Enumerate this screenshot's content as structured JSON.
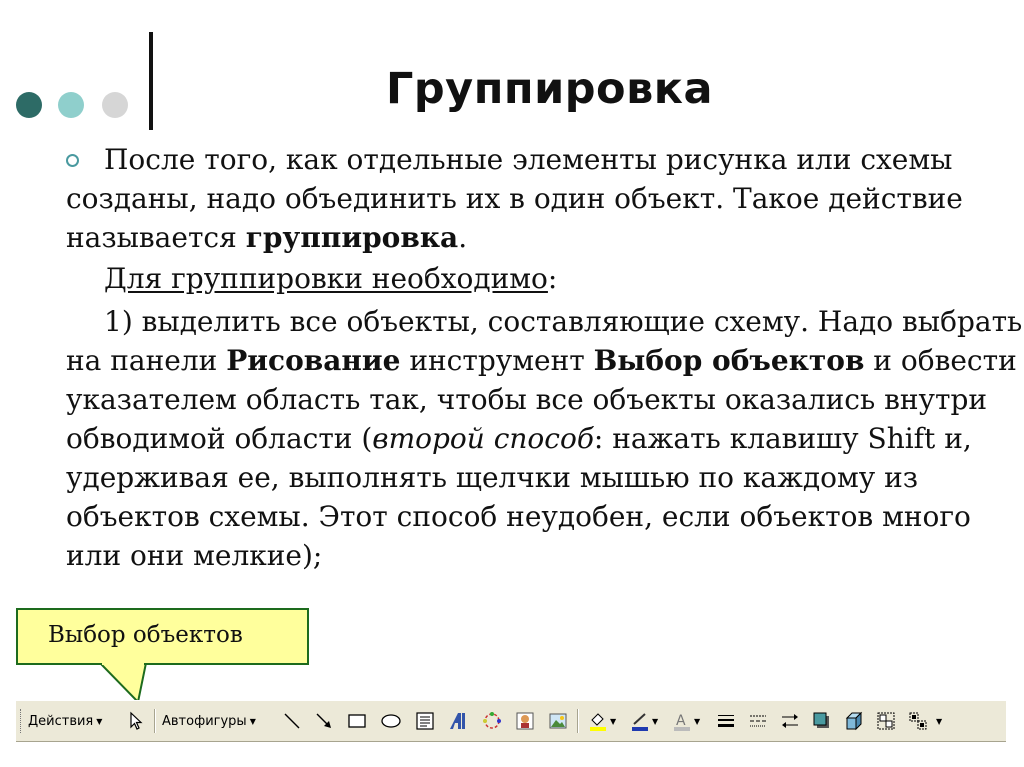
{
  "slide": {
    "title": "Группировка",
    "p1_a": "После того, как отдельные элементы рисунка или схемы созданы, надо объединить их в один объект. Такое действие называется ",
    "p1_bold": "группировка",
    "p1_end": ".",
    "p2_underlined": "Для группировки необходимо",
    "p2_end": ":",
    "p3_a": "1) выделить все объекты, составляющие схему. Надо выбрать на панели ",
    "p3_bold1": "Рисование",
    "p3_b": " инструмент ",
    "p3_bold2": "Выбор объектов",
    "p3_c": " и обвести указателем область так, чтобы все объекты оказались внутри обводимой области (",
    "p3_italic": "второй способ",
    "p3_d": ": нажать клавишу Shift и, удерживая ее, выполнять щелчки мышью по каждому из объектов схемы. Этот способ неудобен, если объектов много или они мелкие);"
  },
  "callout": {
    "label": "Выбор объектов"
  },
  "toolbar": {
    "actions_label": "Действия",
    "autoshapes_label": "Автофигуры"
  },
  "colors": {
    "dot_dark": "#2d6b66",
    "dot_mid": "#8fcfcc",
    "dot_light": "#d6d6d6",
    "bullet": "#4a9aa0",
    "callout_fill": "#ffff9c",
    "callout_border": "#1d6b1d",
    "toolbar_bg": "#ece9d8"
  }
}
